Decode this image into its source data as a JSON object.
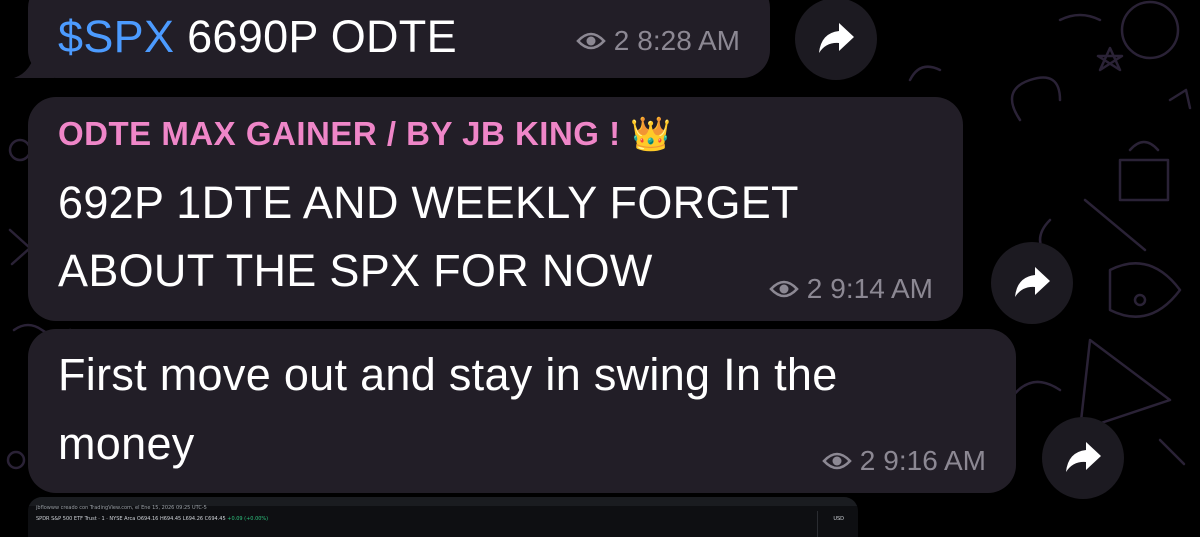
{
  "messages": [
    {
      "ticker": "$SPX",
      "text": " 6690P ODTE",
      "views": "2",
      "time": "8:28 AM"
    },
    {
      "sender": "ODTE MAX GAINER / BY JB KING ! 👑",
      "lines": [
        "692P 1DTE AND WEEKLY FORGET",
        "ABOUT THE SPX FOR NOW"
      ],
      "views": "2",
      "time": "9:14 AM"
    },
    {
      "lines": [
        "First move out and stay in swing In the",
        "money"
      ],
      "views": "2",
      "time": "9:16 AM"
    }
  ],
  "chart_preview": {
    "caption": "jbflowww creado con TradingView.com, el Ene 15, 2026 09:25 UTC-5",
    "symbol_line": "SPDR S&P 500 ETF Trust · 1 · NYSE Arca",
    "values": "O694.16 H694.45 L694.26 C694.45",
    "change": "+0.09 (+0.00%)",
    "currency": "USD"
  },
  "icons": {
    "views": "eye-icon",
    "forward": "forward-arrow-icon"
  },
  "colors": {
    "bubble": "#221e27",
    "ticker": "#4c9bff",
    "sender": "#ef86c8",
    "meta": "#8c8893",
    "background": "#000000"
  }
}
